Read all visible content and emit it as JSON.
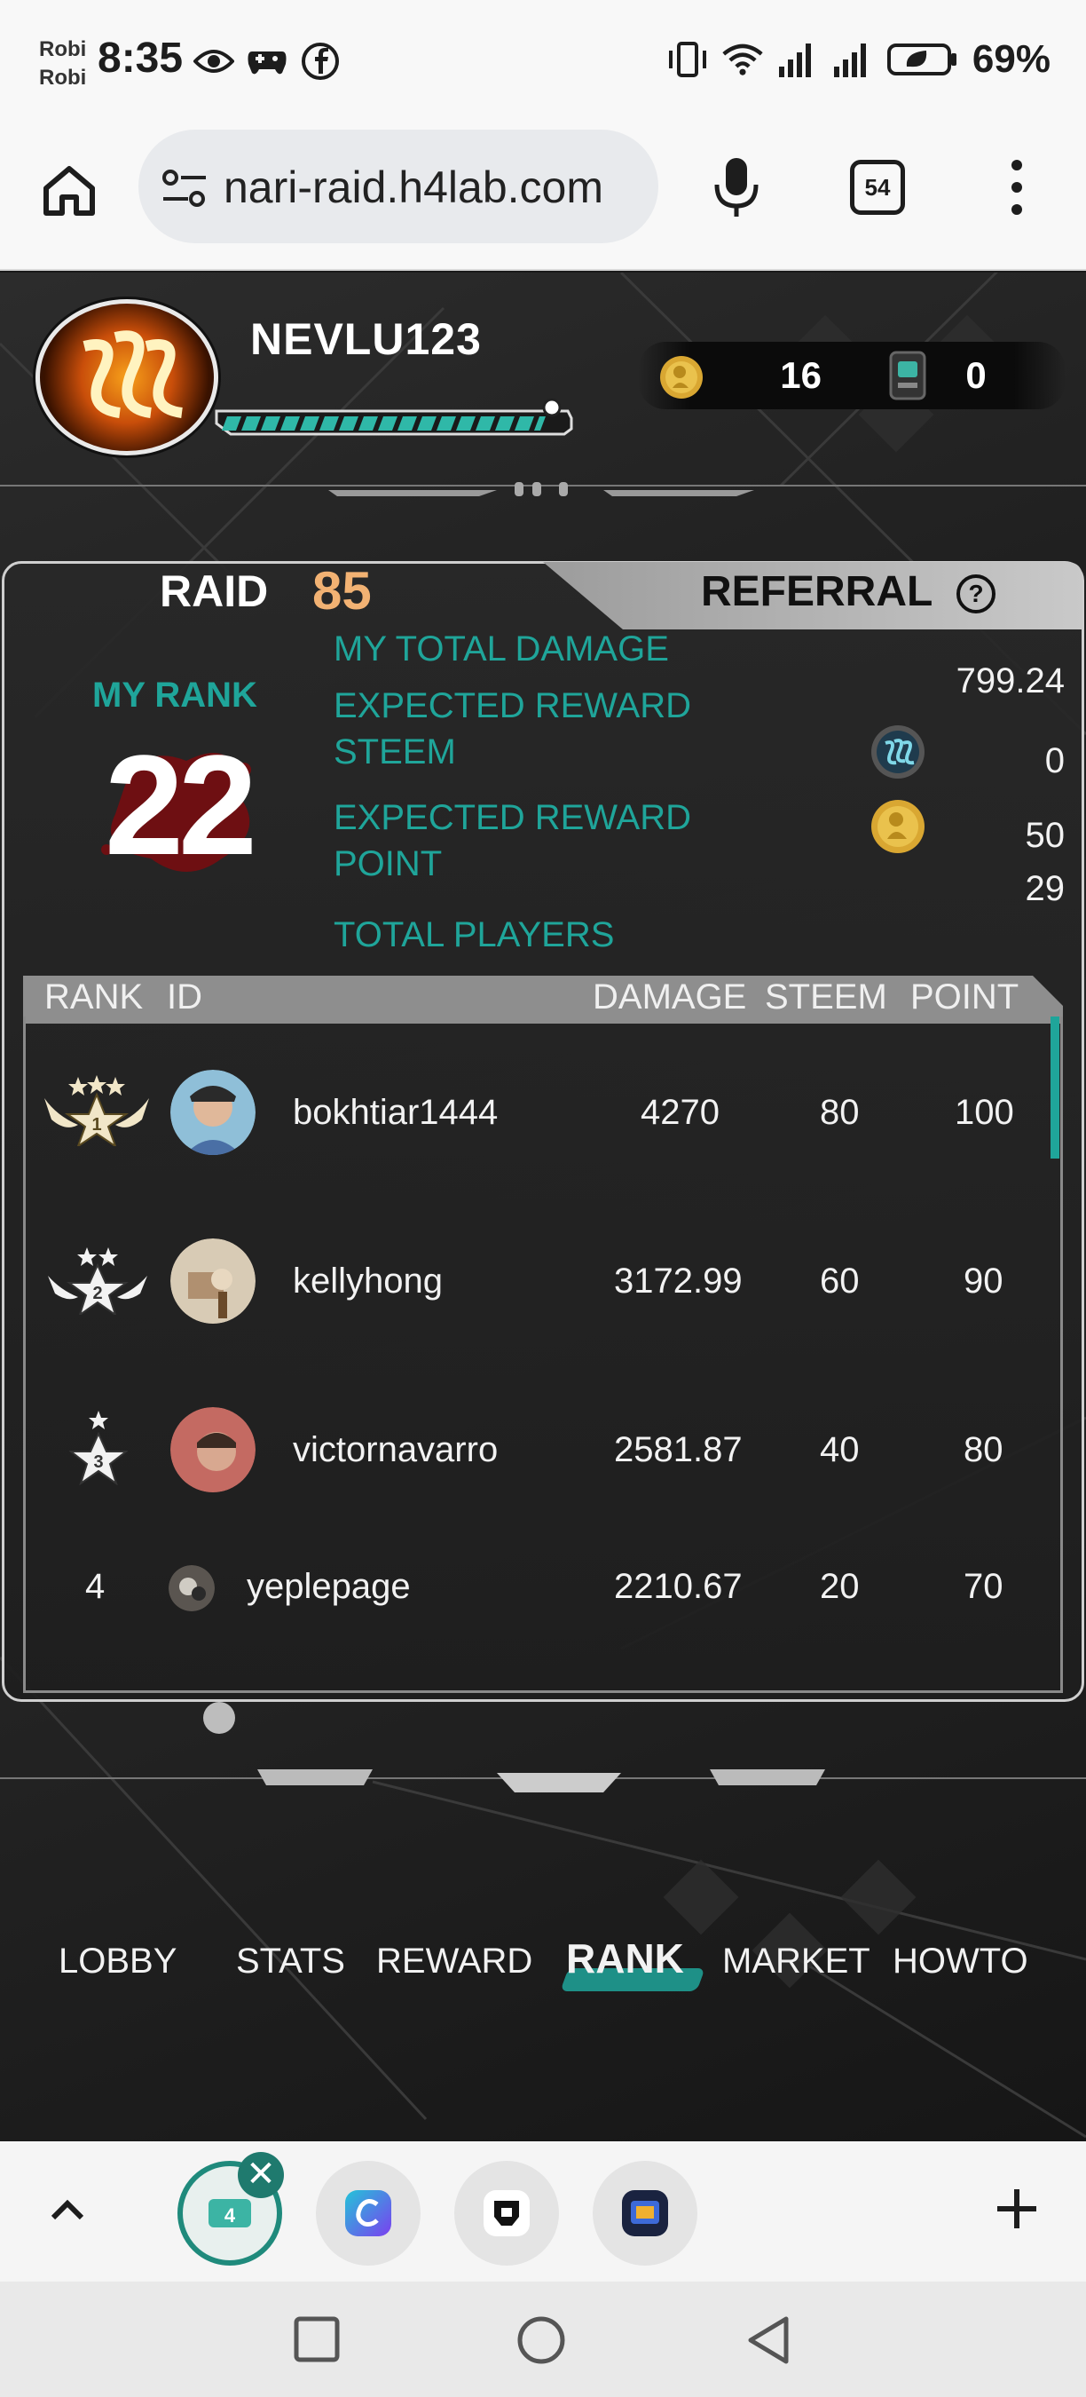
{
  "status_bar": {
    "carrier_line1": "Robi",
    "carrier_line2": "Robi",
    "time": "8:35",
    "battery": "69%",
    "left_icons": [
      "eye-icon",
      "gamepad-icon",
      "facebook-icon"
    ],
    "right_icons": [
      "vibrate-icon",
      "wifi-icon",
      "signal-icon",
      "signal-icon",
      "battery-saver-icon"
    ]
  },
  "browser": {
    "url": "nari-raid.h4lab.com",
    "tab_count": "54"
  },
  "player": {
    "name": "NEVLU123",
    "xp_fraction": 0.93,
    "coins": "16",
    "tickets": "0"
  },
  "panel": {
    "raid_label": "RAID",
    "raid_number": "85",
    "referral_label": "REFERRAL",
    "help_symbol": "?",
    "my_rank_label": "MY RANK",
    "my_rank_value": "22",
    "stats": {
      "total_damage_label": "MY TOTAL DAMAGE",
      "total_damage_value": "799.24",
      "reward_steem_label_1": "EXPECTED REWARD",
      "reward_steem_label_2": "STEEM",
      "reward_steem_value": "0",
      "reward_point_label_1": "EXPECTED REWARD",
      "reward_point_label_2": "POINT",
      "reward_point_value": "50",
      "total_players_label": "TOTAL PLAYERS",
      "total_players_value": "29"
    }
  },
  "table": {
    "headers": {
      "rank": "RANK",
      "id": "ID",
      "damage": "DAMAGE",
      "steem": "STEEM",
      "point": "POINT"
    },
    "rows": [
      {
        "rank": "1",
        "id": "bokhtiar1444",
        "damage": "4270",
        "steem": "80",
        "point": "100"
      },
      {
        "rank": "2",
        "id": "kellyhong",
        "damage": "3172.99",
        "steem": "60",
        "point": "90"
      },
      {
        "rank": "3",
        "id": "victornavarro",
        "damage": "2581.87",
        "steem": "40",
        "point": "80"
      },
      {
        "rank": "4",
        "id": "yeplepage",
        "damage": "2210.67",
        "steem": "20",
        "point": "70"
      }
    ]
  },
  "game_nav": {
    "items": [
      "LOBBY",
      "STATS",
      "REWARD",
      "RANK",
      "MARKET",
      "HOWTO"
    ],
    "active": "RANK"
  },
  "tab_strip": {
    "close_symbol": "✕"
  },
  "colors": {
    "accent_teal": "#1fa59a",
    "raid_number": "#f2b273",
    "panel_bg": "#262626"
  }
}
